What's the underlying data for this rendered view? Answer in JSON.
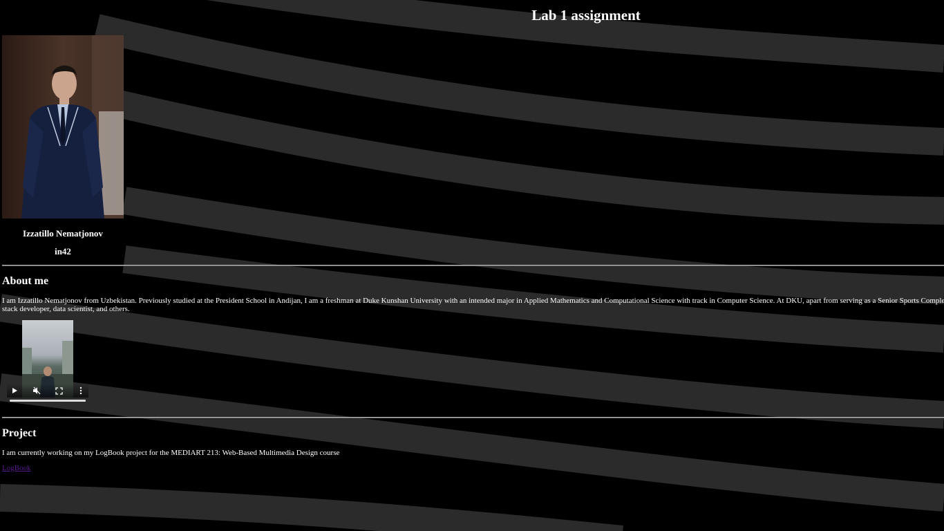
{
  "header": {
    "title": "Lab 1 assignment"
  },
  "profile": {
    "photo_alt": "Izzatillo Nematjonov",
    "name": "Izzatillo Nematjonov",
    "id": "in42"
  },
  "about": {
    "heading": "About me",
    "line1": "I am Izzatillo Nematjonov from Uzbekistan. Previously studied at the President School in Andijan, I am a freshman at Duke Kunshan University with an intended major in Applied Mathematics and Computational Science with track in Computer Science. At DKU, apart from serving as a Senior Sports Complex associate, I",
    "line2": "stack developer, data scientist, and others."
  },
  "video": {
    "play_icon": "play-icon",
    "mute_icon": "muted-speaker-icon",
    "fullscreen_icon": "fullscreen-icon",
    "menu_icon": "more-vertical-icon"
  },
  "project": {
    "heading": "Project",
    "text": "I am currently working on my LogBook project for the MEDIART 213: Web-Based Multimedia Design course",
    "link_text": "LogBook"
  },
  "colors": {
    "background": "#000000",
    "stripes": "#2b2b2b",
    "text": "#ffffff",
    "visited_link": "#551a8b"
  }
}
